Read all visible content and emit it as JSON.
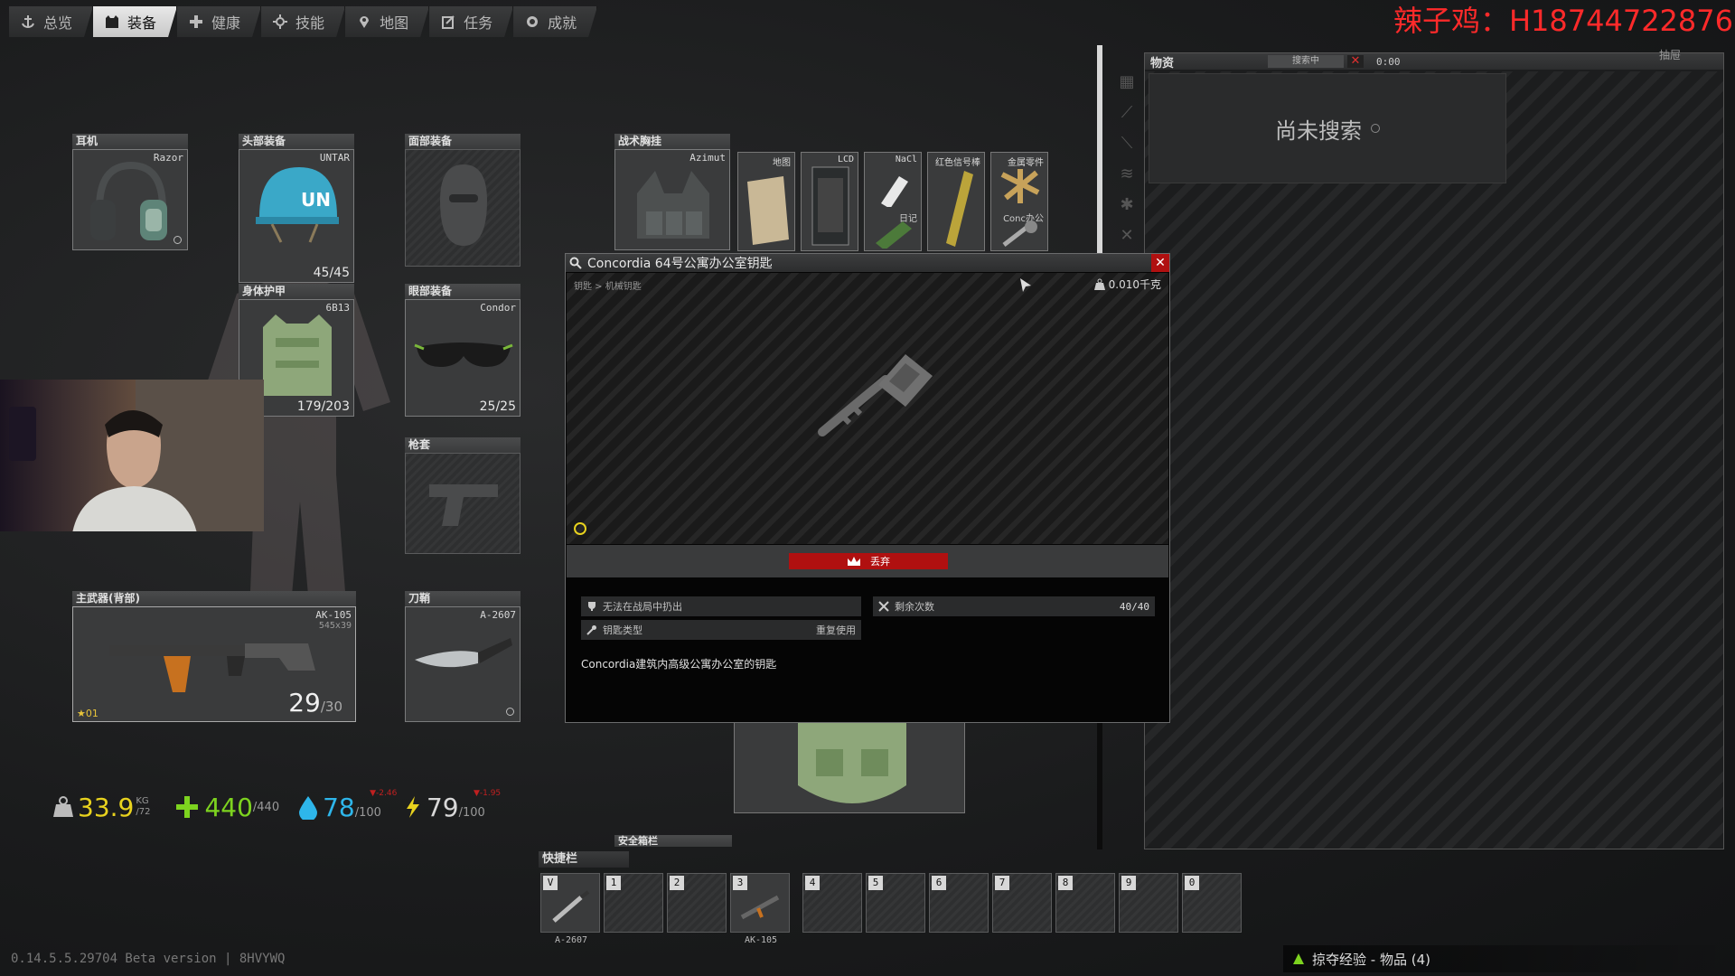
{
  "nav": {
    "tabs": [
      {
        "label": "总览",
        "icon": "anchor-icon"
      },
      {
        "label": "装备",
        "icon": "vest-icon"
      },
      {
        "label": "健康",
        "icon": "health-icon"
      },
      {
        "label": "技能",
        "icon": "skills-icon"
      },
      {
        "label": "地图",
        "icon": "map-pin-icon"
      },
      {
        "label": "任务",
        "icon": "tasks-icon"
      },
      {
        "label": "成就",
        "icon": "achievement-icon"
      }
    ],
    "active": "装备"
  },
  "watermark": "辣子鸡：H18744722876",
  "slots": {
    "earpiece": {
      "label": "耳机",
      "item": "Razor"
    },
    "headwear": {
      "label": "头部装备",
      "item": "UNTAR",
      "durability": "45/45"
    },
    "face": {
      "label": "面部装备"
    },
    "armor": {
      "label": "身体护甲",
      "item": "6B13",
      "durability": "179/203"
    },
    "eyewear": {
      "label": "眼部装备",
      "item": "Condor",
      "durability": "25/25"
    },
    "holster": {
      "label": "枪套"
    },
    "primary": {
      "label": "主武器(背部)",
      "item": "AK-105",
      "caliber": "545x39",
      "ammo": "29",
      "ammo_max": "/30",
      "rank": "01"
    },
    "scabbard": {
      "label": "刀鞘",
      "item": "A-2607"
    },
    "rig": {
      "label": "战术胸挂",
      "item": "Azimut"
    },
    "secure": {
      "label": "安全箱栏"
    }
  },
  "rig_items": [
    {
      "name": "地图"
    },
    {
      "name": "LCD"
    },
    {
      "name": "NaCl",
      "sub": "日记"
    },
    {
      "name": "红色信号棒"
    },
    {
      "name": "金属零件",
      "sub": "Conc办公"
    }
  ],
  "stats": {
    "weight": "33.9",
    "weight_unit": "KG",
    "weight_max": "/72",
    "health": "440",
    "health_max": "/440",
    "hydration": "78",
    "hydration_max": "/100",
    "hydration_rate": "▼-2.46",
    "energy": "79",
    "energy_max": "/100",
    "energy_rate": "▼-1.95"
  },
  "loot": {
    "title": "物资",
    "search_label": "搜索中",
    "timer": "0:00",
    "not_searched": "尚未搜索",
    "corner_label": "抽屉"
  },
  "modal": {
    "title": "Concordia 64号公寓办公室钥匙",
    "breadcrumb": "钥匙 > 机械钥匙",
    "weight": "0.010千克",
    "discard_label": "丢弃",
    "stat1_label": "无法在战局中扔出",
    "stat2_label": "钥匙类型",
    "stat2_value": "重复使用",
    "stat3_label": "剩余次数",
    "stat3_value": "40/40",
    "description": "Concordia建筑内高级公寓办公室的钥匙"
  },
  "quickbar": {
    "label": "快捷栏",
    "slots": [
      {
        "key": "V",
        "item": "A-2607"
      },
      {
        "key": "1",
        "item": ""
      },
      {
        "key": "2",
        "item": ""
      },
      {
        "key": "3",
        "item": "AK-105"
      },
      {
        "key": "4",
        "item": ""
      },
      {
        "key": "5",
        "item": ""
      },
      {
        "key": "6",
        "item": ""
      },
      {
        "key": "7",
        "item": ""
      },
      {
        "key": "8",
        "item": ""
      },
      {
        "key": "9",
        "item": ""
      },
      {
        "key": "0",
        "item": ""
      }
    ]
  },
  "footer": {
    "version": "0.14.5.5.29704 Beta version | 8HVYWQ",
    "loot_xp": "掠夺经验 - 物品 (4)"
  },
  "colors": {
    "accent_red": "#b01010",
    "health_green": "#7dd31f",
    "water_blue": "#2eb6ea",
    "weight_yellow": "#e8d21e"
  }
}
